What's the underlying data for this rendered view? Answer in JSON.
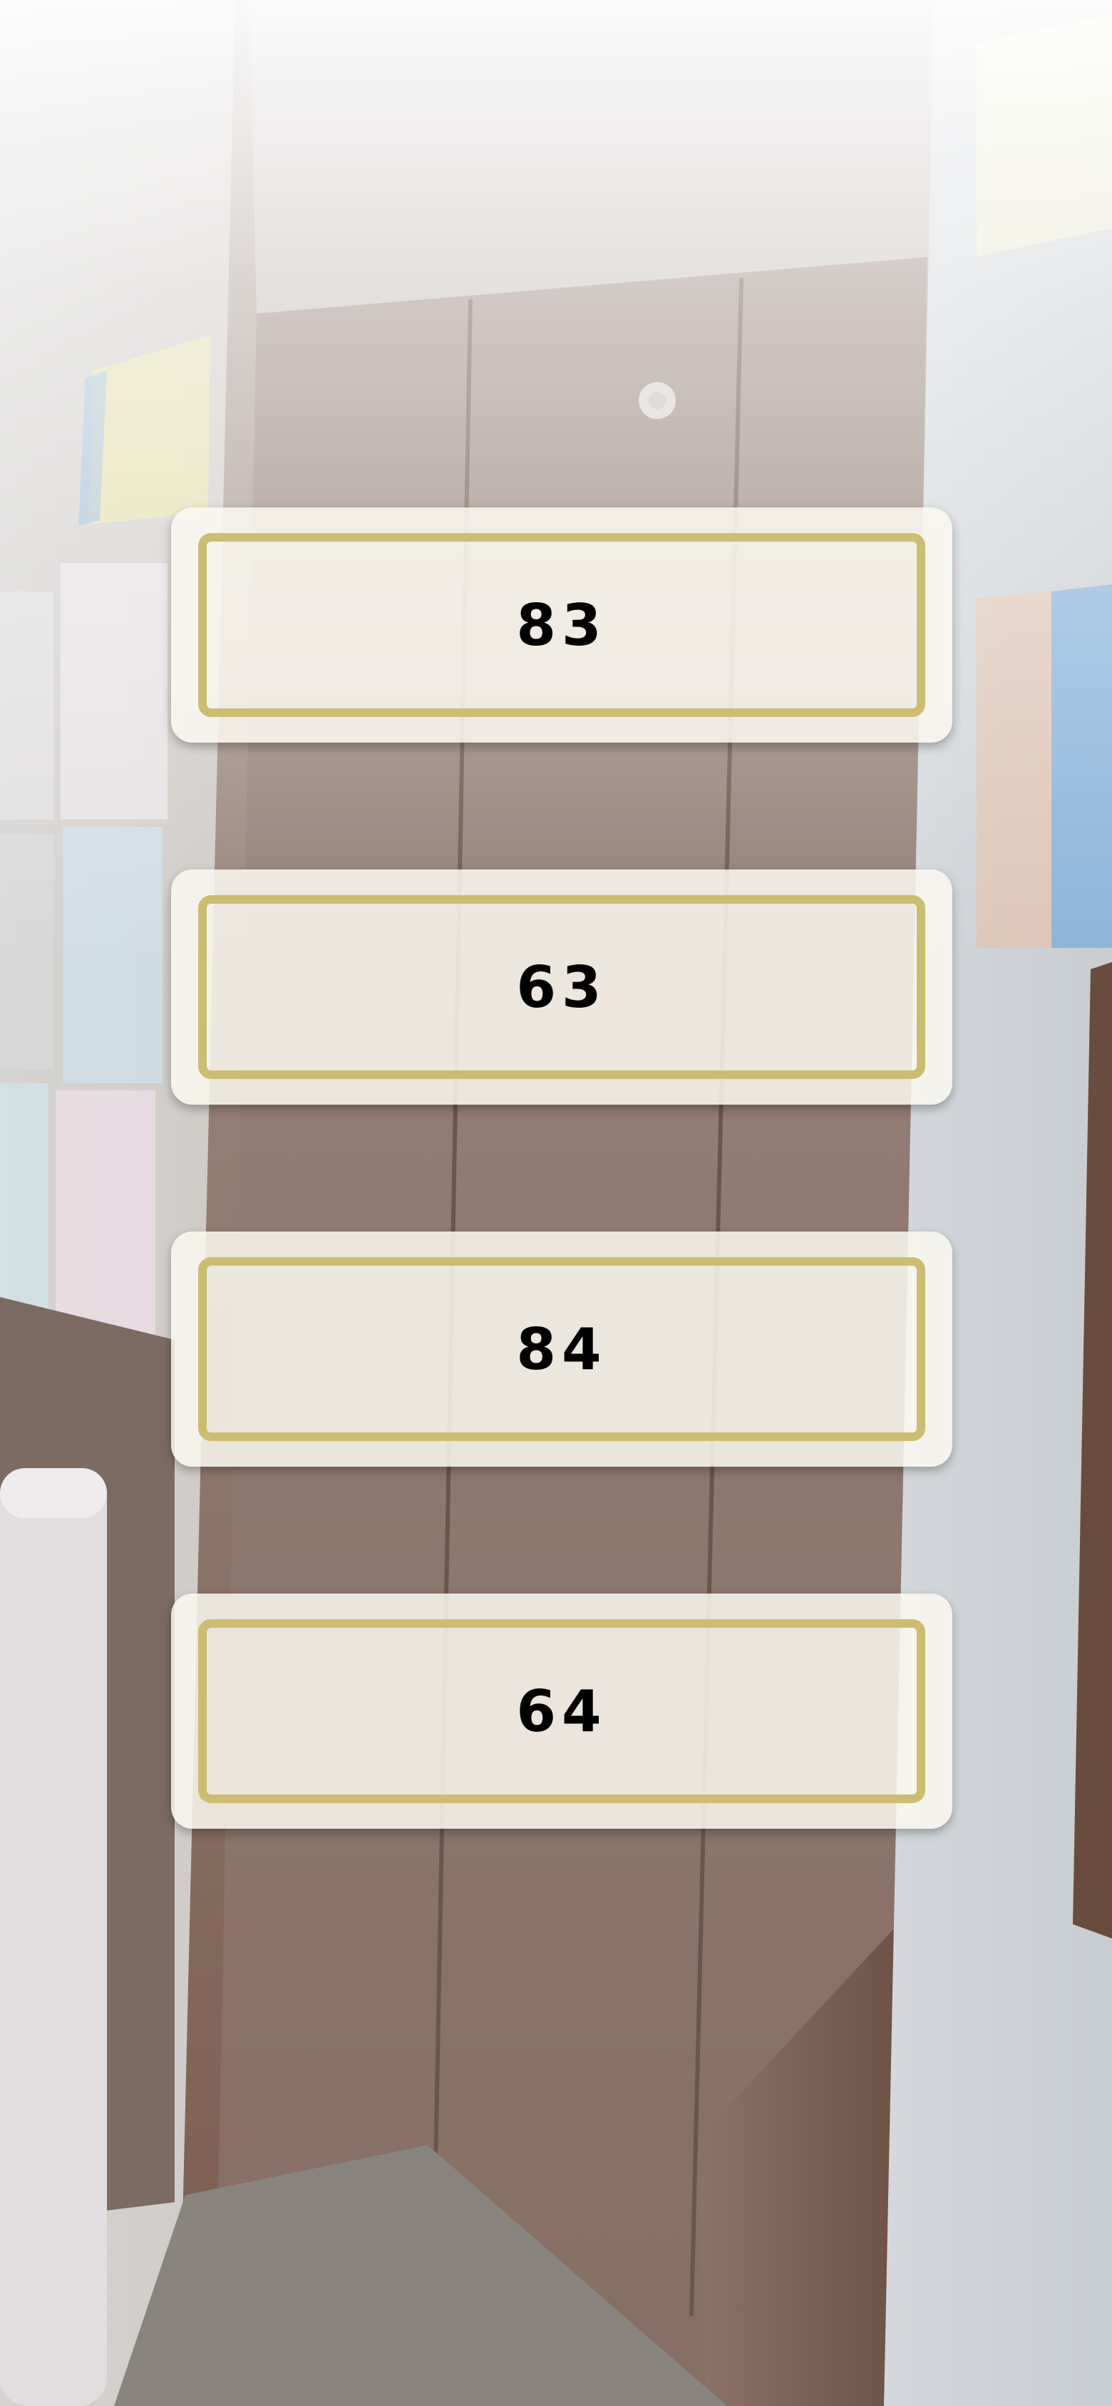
{
  "colors": {
    "card_background": "#faf8f0",
    "card_border": "#cdbd72",
    "text": "#000000"
  },
  "options": [
    {
      "label": "83"
    },
    {
      "label": "63"
    },
    {
      "label": "84"
    },
    {
      "label": "64"
    }
  ]
}
